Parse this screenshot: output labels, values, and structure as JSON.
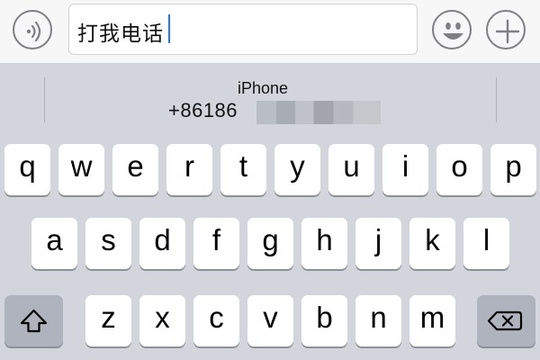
{
  "input_bar": {
    "text_value": "打我电话",
    "voice_icon": "voice-input-icon",
    "emoji_icon": "emoji-icon",
    "plus_icon": "plus-icon"
  },
  "suggestion": {
    "title": "iPhone",
    "phone": "+86186"
  },
  "keyboard": {
    "row1": [
      "q",
      "w",
      "e",
      "r",
      "t",
      "y",
      "u",
      "i",
      "o",
      "p"
    ],
    "row2": [
      "a",
      "s",
      "d",
      "f",
      "g",
      "h",
      "j",
      "k",
      "l"
    ],
    "row3": [
      "z",
      "x",
      "c",
      "v",
      "b",
      "n",
      "m"
    ],
    "shift_icon": "shift-icon",
    "backspace_icon": "backspace-icon"
  },
  "colors": {
    "keyboard_bg": "#d2d5db",
    "key_bg": "#ffffff",
    "special_key_bg": "#aeb3bd",
    "caret": "#1f7cf6"
  }
}
